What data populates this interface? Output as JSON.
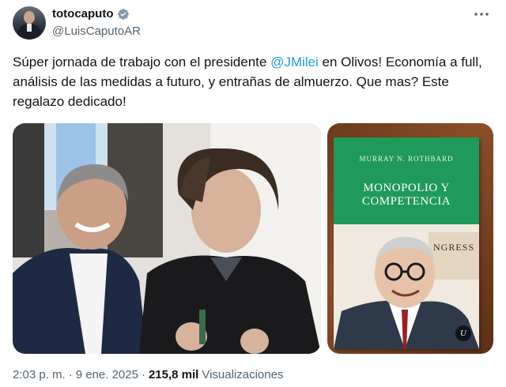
{
  "author": {
    "display_name": "totocaputo",
    "handle": "@LuisCaputoAR"
  },
  "tweet": {
    "text_part1": "Súper jornada de trabajo con el presidente ",
    "mention": "@JMilei",
    "text_part2": " en Olivos! Economía a full, análisis de las medidas a futuro, y entrañas de almuerzo. Que mas? Este regalazo dedicado!"
  },
  "book": {
    "author": "MURRAY N. ROTHBARD",
    "title": "MONOPOLIO Y COMPETENCIA",
    "art_text": "NGRESS",
    "publisher_logo": "U"
  },
  "footer": {
    "time": "2:03 p. m.",
    "separator1": "·",
    "date": "9 ene. 2025",
    "separator2": "·",
    "views_count": "215,8 mil",
    "views_label": "Visualizaciones"
  },
  "colors": {
    "link": "#1d9bf0",
    "secondary_text": "#536471",
    "primary_text": "#0f1419",
    "verified_badge": "#829aab",
    "book_cover": "#1f9a5a"
  },
  "icons": {
    "verified": "verified-badge-icon",
    "more": "more-options-icon"
  }
}
